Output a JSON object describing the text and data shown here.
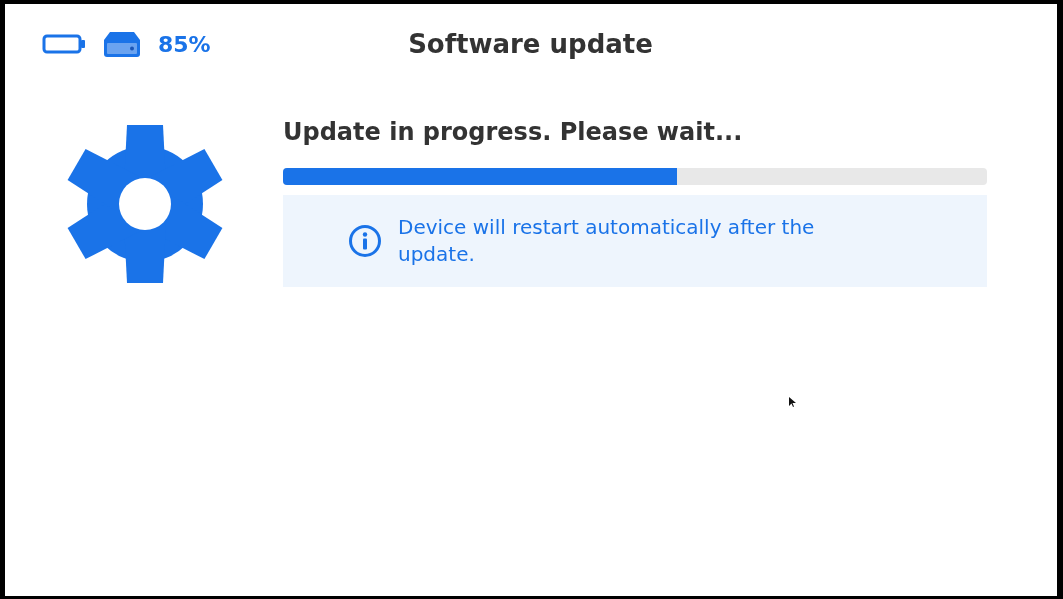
{
  "header": {
    "storage_percent": "85%",
    "title": "Software update"
  },
  "update": {
    "message": "Update in progress. Please wait...",
    "progress": {
      "level": 0.56
    },
    "info": "Device will restart automatically after the update."
  }
}
